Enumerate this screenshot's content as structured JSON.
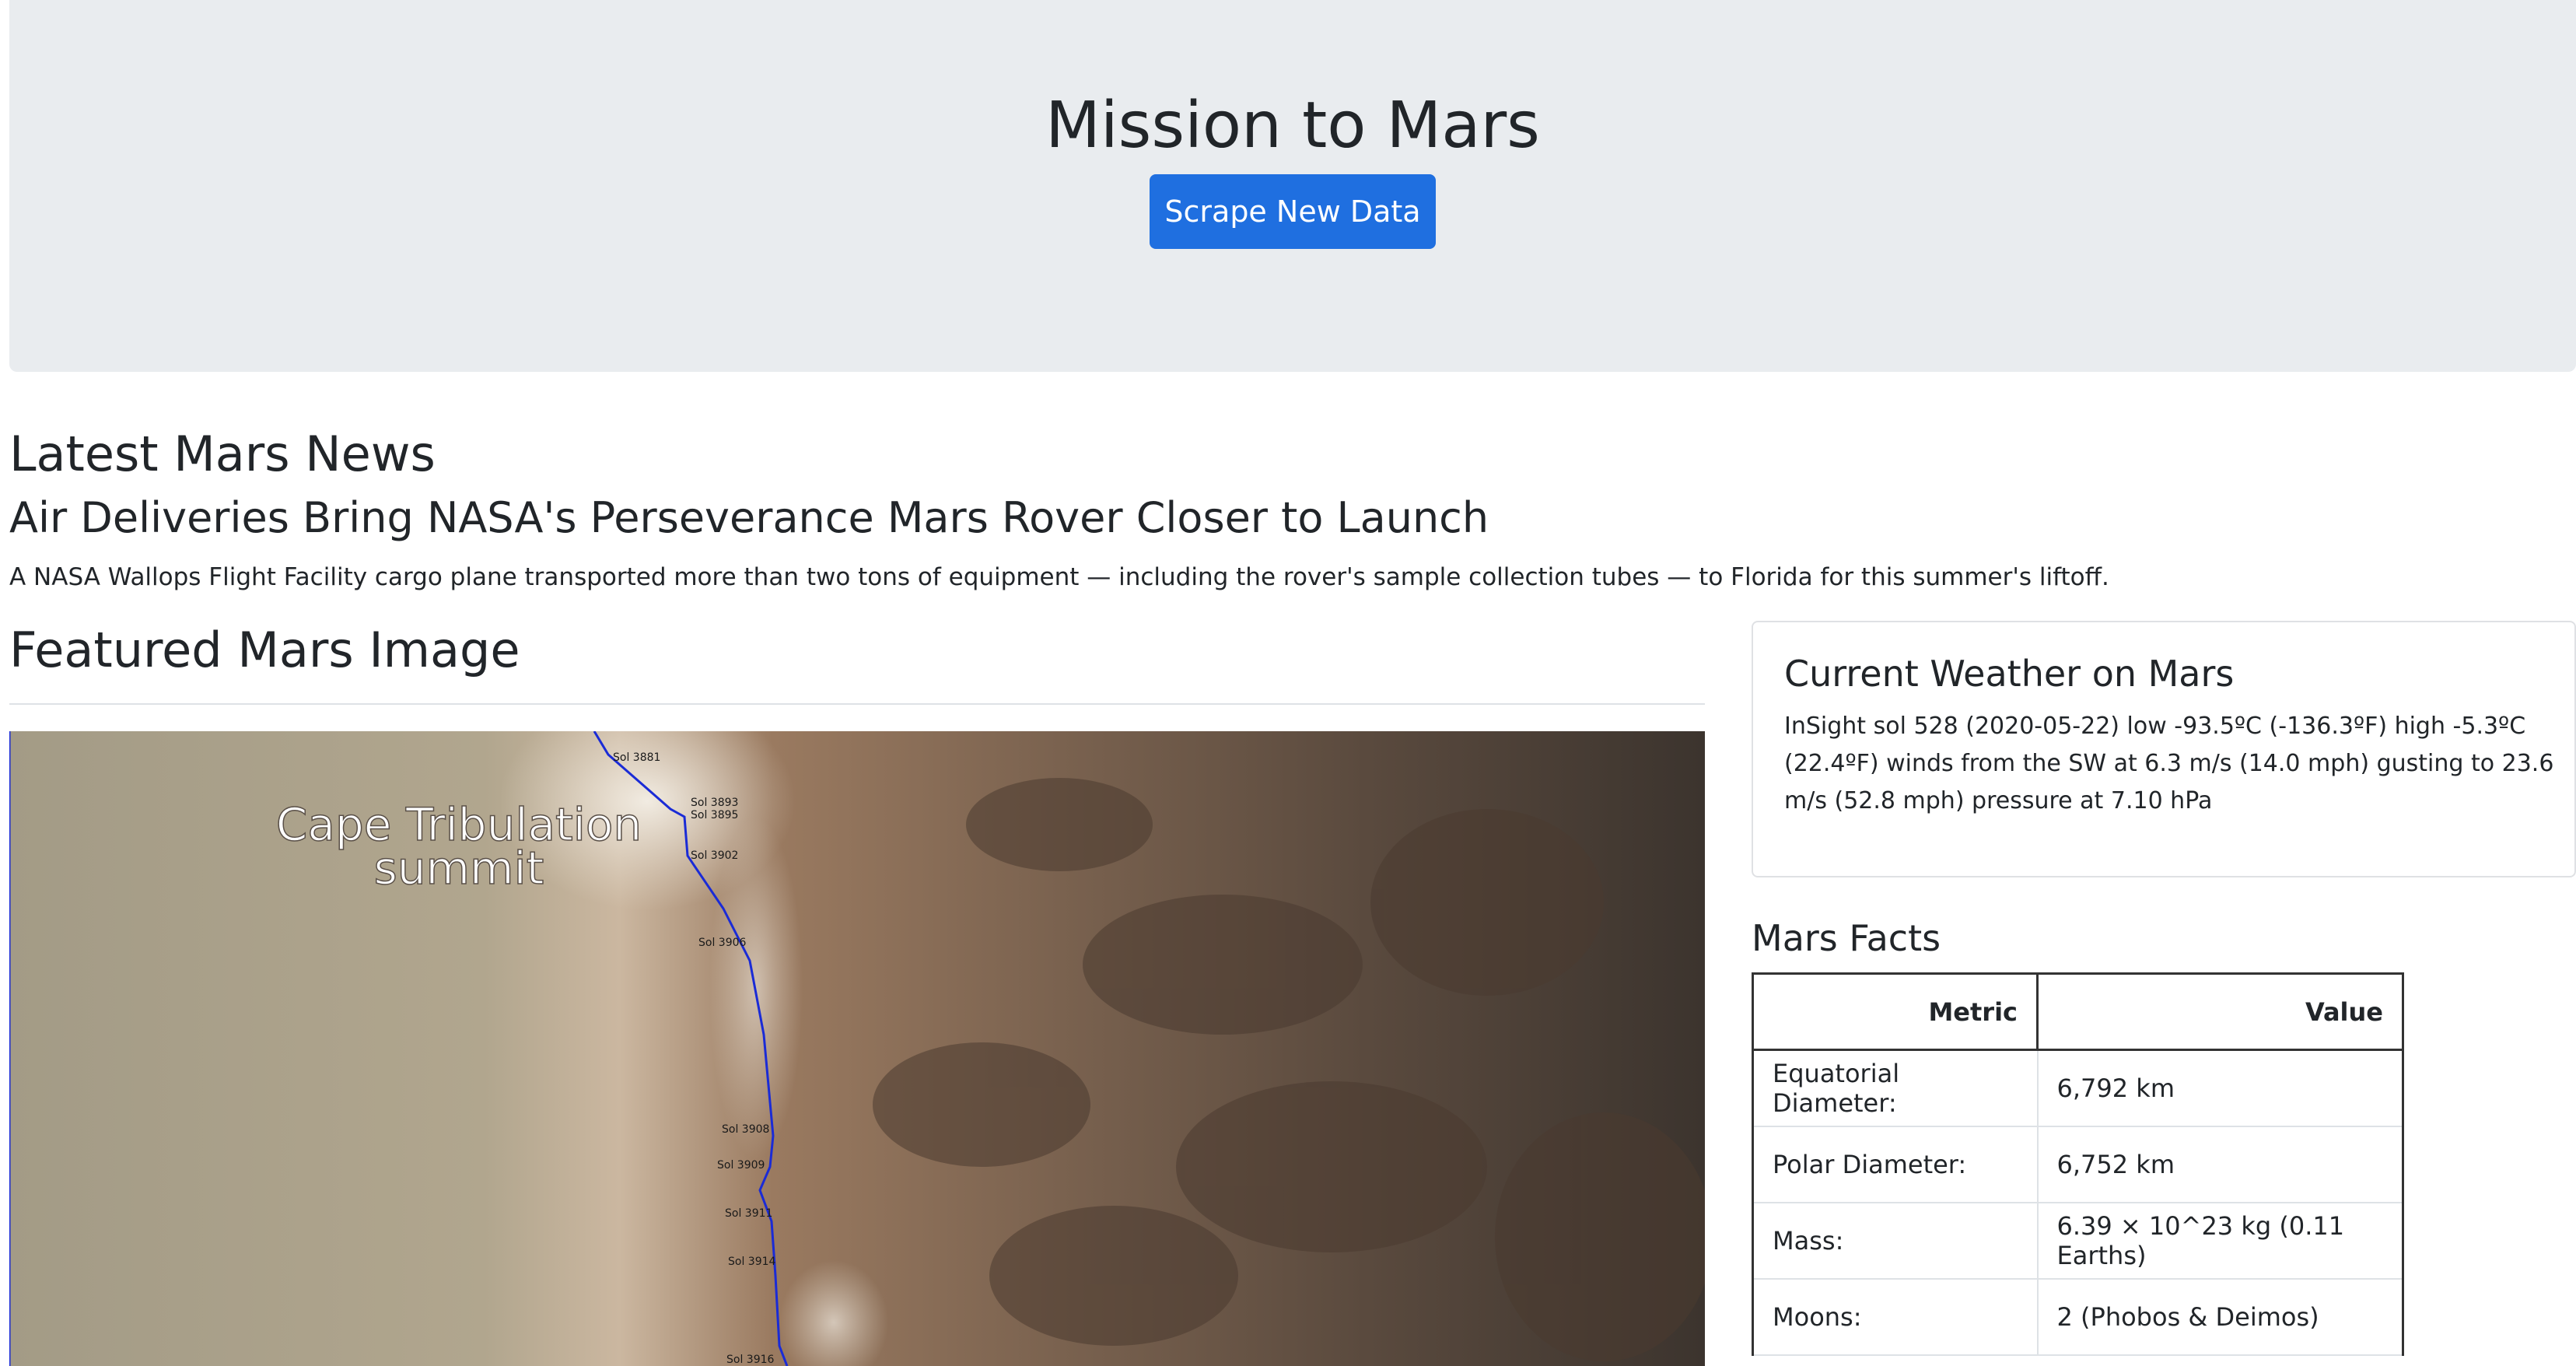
{
  "header": {
    "title": "Mission to Mars",
    "scrape_button_label": "Scrape New Data"
  },
  "news": {
    "section_heading": "Latest Mars News",
    "title": "Air Deliveries Bring NASA's Perseverance Mars Rover Closer to Launch",
    "teaser": "A NASA Wallops Flight Facility cargo plane transported more than two tons of equipment — including the rover's sample collection tubes — to Florida for this summer's liftoff."
  },
  "featured_image": {
    "section_heading": "Featured Mars Image",
    "caption_line1": "Cape Tribulation",
    "caption_line2": "summit",
    "path_labels": [
      "Sol 3881",
      "Sol 3893",
      "Sol 3895",
      "Sol 3902",
      "Sol 3906",
      "Sol 3908",
      "Sol 3909",
      "Sol 3911",
      "Sol 3914",
      "Sol 3916"
    ],
    "path_color": "#1a2bd6"
  },
  "weather": {
    "heading": "Current Weather on Mars",
    "text": "InSight sol 528 (2020-05-22) low -93.5ºC (-136.3ºF) high -5.3ºC (22.4ºF) winds from the SW at 6.3 m/s (14.0 mph) gusting to 23.6 m/s (52.8 mph) pressure at 7.10 hPa"
  },
  "facts": {
    "heading": "Mars Facts",
    "columns": [
      "Metric",
      "Value"
    ],
    "rows": [
      {
        "metric": "Equatorial Diameter:",
        "value": "6,792 km"
      },
      {
        "metric": "Polar Diameter:",
        "value": "6,752 km"
      },
      {
        "metric": "Mass:",
        "value": "6.39 × 10^23 kg (0.11 Earths)"
      },
      {
        "metric": "Moons:",
        "value": "2 (Phobos & Deimos)"
      }
    ]
  },
  "colors": {
    "jumbotron_bg": "#e9ecef",
    "button_bg": "#1f6fe0",
    "text": "#212529"
  }
}
